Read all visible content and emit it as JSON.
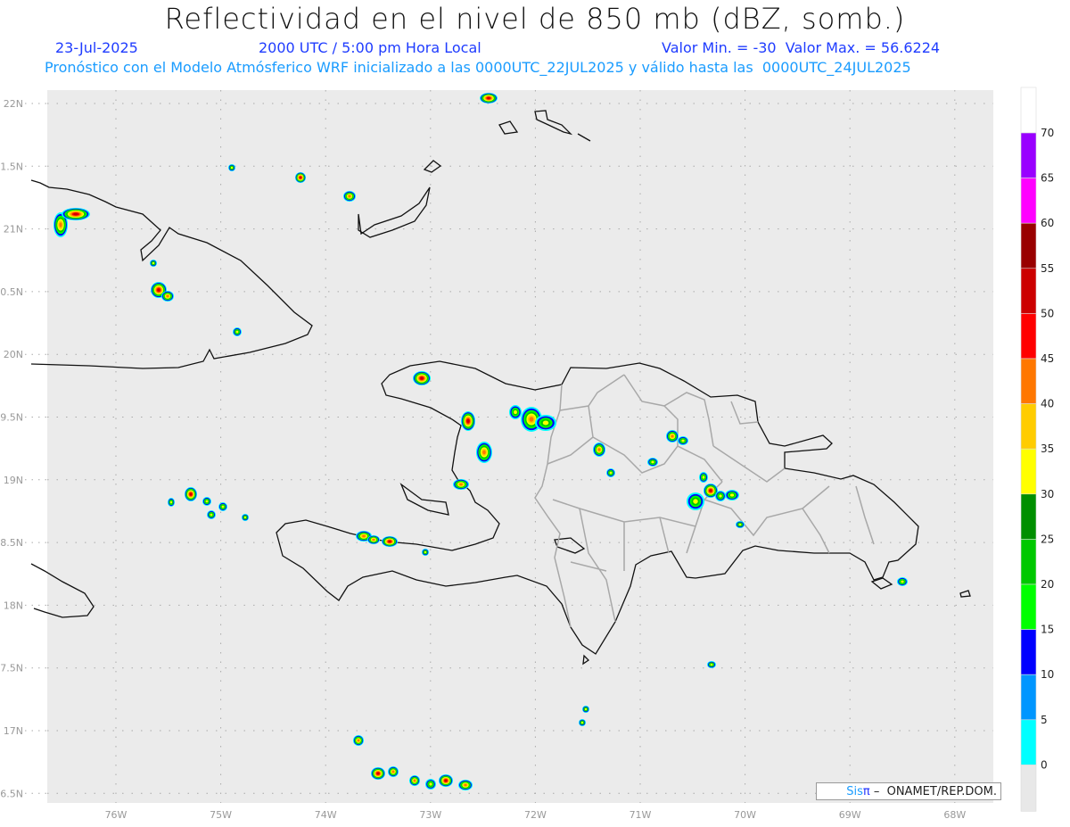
{
  "header": {
    "title": "Reflectividad en el nivel de 850 mb (dBZ, somb.)",
    "date": "23-Jul-2025",
    "time": "2000 UTC / 5:00 pm Hora Local",
    "min_max": "Valor Min. = -30  Valor Max. = 56.6224",
    "forecast": "Pronóstico con el Modelo Atmósferico WRF inicializado a las 0000UTC_22JUL2025 y válido hasta las  0000UTC_24JUL2025"
  },
  "axes": {
    "lat_labels": [
      "22N",
      "1.5N",
      "21N",
      "0.5N",
      "20N",
      "9.5N",
      "19N",
      "8.5N",
      "18N",
      "7.5N",
      "17N",
      "6.5N"
    ],
    "lon_labels": [
      "76W",
      "75W",
      "74W",
      "73W",
      "72W",
      "71W",
      "70W",
      "69W",
      "68W"
    ]
  },
  "colorbar": {
    "labels": [
      "70",
      "65",
      "60",
      "55",
      "50",
      "45",
      "40",
      "35",
      "30",
      "25",
      "20",
      "15",
      "10",
      "5",
      "0"
    ],
    "colors": [
      "#ffffff",
      "#9900ff",
      "#ff00ff",
      "#990000",
      "#cc0000",
      "#ff0000",
      "#ff7700",
      "#ffcc00",
      "#ffff00",
      "#008f00",
      "#00c800",
      "#00ff00",
      "#0000ff",
      "#0096ff",
      "#00ffff",
      "#e8e8e8"
    ]
  },
  "credit": {
    "brand_a": "Sis",
    "brand_b": "π",
    "text": " –  ONAMET/REP.DOM."
  }
}
